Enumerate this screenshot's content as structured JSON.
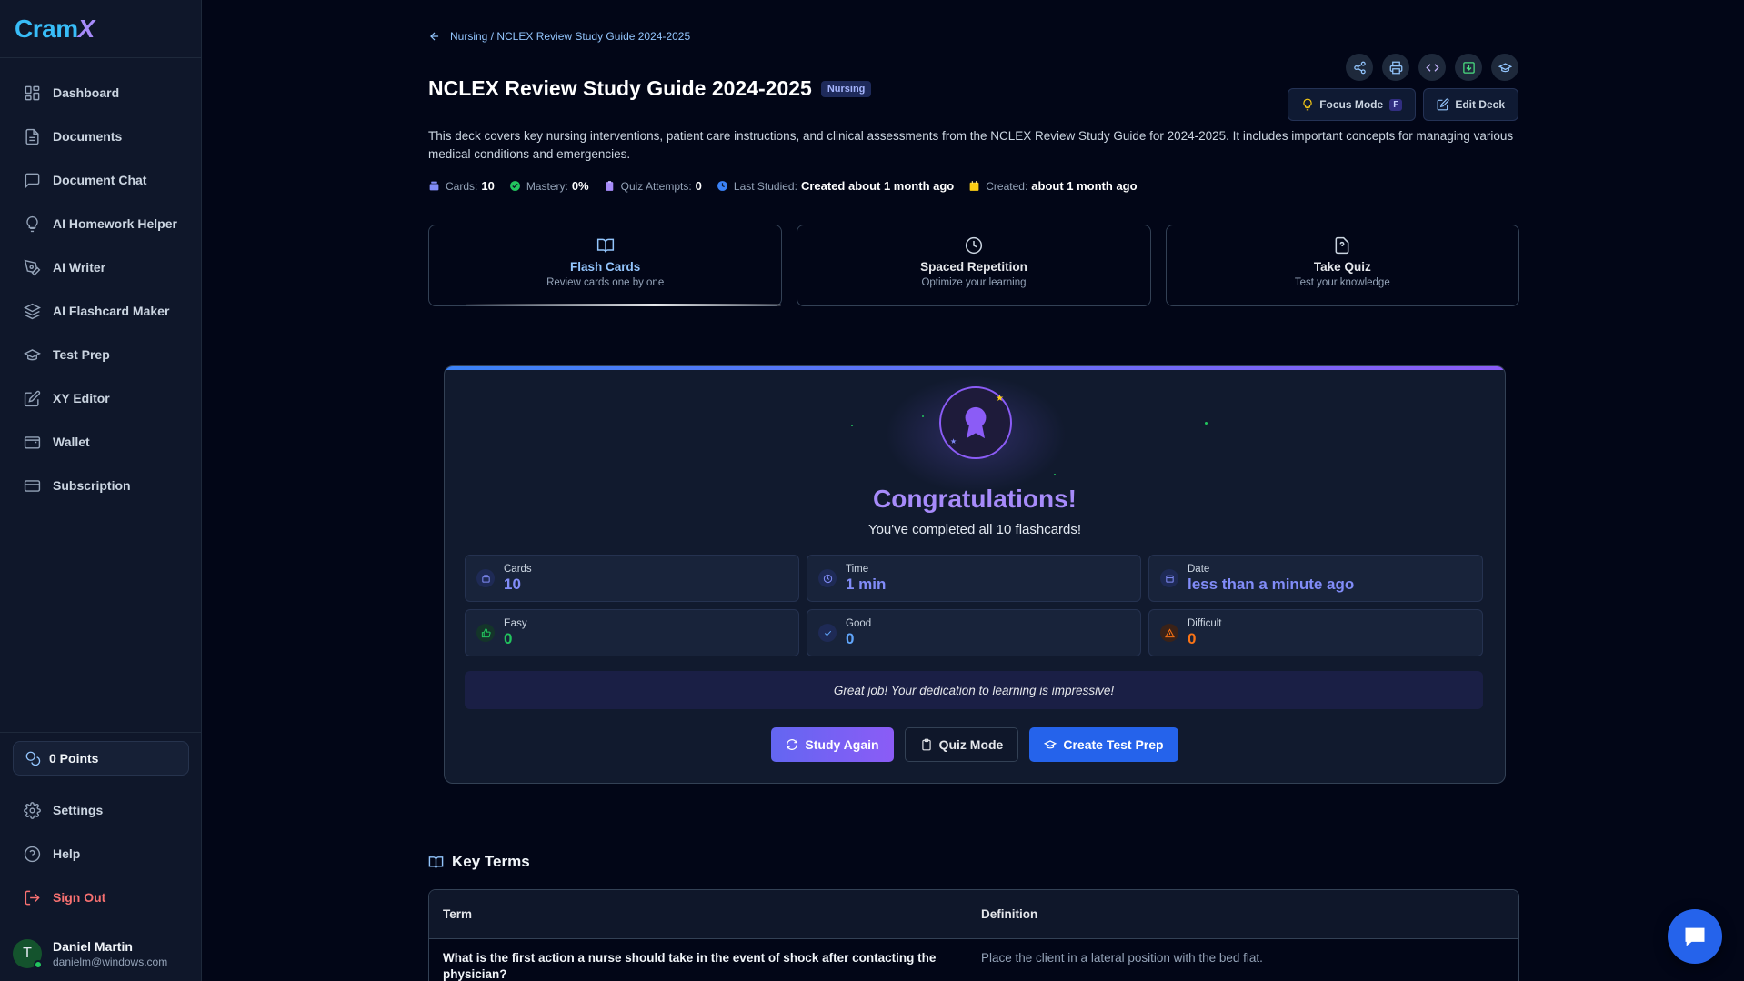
{
  "app": {
    "logo_a": "Cram",
    "logo_b": "X"
  },
  "sidebar": {
    "items": [
      {
        "label": "Dashboard",
        "icon": "grid-icon"
      },
      {
        "label": "Documents",
        "icon": "document-icon"
      },
      {
        "label": "Document Chat",
        "icon": "chat-icon"
      },
      {
        "label": "AI Homework Helper",
        "icon": "lightbulb-icon"
      },
      {
        "label": "AI Writer",
        "icon": "pen-tool-icon"
      },
      {
        "label": "AI Flashcard Maker",
        "icon": "layers-icon"
      },
      {
        "label": "Test Prep",
        "icon": "graduation-cap-icon"
      },
      {
        "label": "XY Editor",
        "icon": "edit-icon"
      },
      {
        "label": "Wallet",
        "icon": "wallet-icon"
      },
      {
        "label": "Subscription",
        "icon": "credit-card-icon"
      }
    ],
    "points": "0 Points",
    "bottom": [
      {
        "label": "Settings",
        "icon": "gear-icon"
      },
      {
        "label": "Help",
        "icon": "help-circle-icon"
      },
      {
        "label": "Sign Out",
        "icon": "logout-icon"
      }
    ],
    "user": {
      "initial": "T",
      "name": "Daniel Martin",
      "email": "danielm@windows.com"
    }
  },
  "header": {
    "breadcrumb": "Nursing / NCLEX Review Study Guide 2024-2025",
    "title": "NCLEX Review Study Guide 2024-2025",
    "tag": "Nursing",
    "focus_mode": "Focus Mode",
    "focus_key": "F",
    "edit_deck": "Edit Deck",
    "description": "This deck covers key nursing interventions, patient care instructions, and clinical assessments from the NCLEX Review Study Guide for 2024-2025. It includes important concepts for managing various medical conditions and emergencies.",
    "meta": {
      "cards_label": "Cards:",
      "cards": "10",
      "mastery_label": "Mastery:",
      "mastery": "0%",
      "quiz_label": "Quiz Attempts:",
      "quiz": "0",
      "last_label": "Last Studied:",
      "last": "Created about 1 month ago",
      "created_label": "Created:",
      "created": "about 1 month ago"
    }
  },
  "modes": [
    {
      "title": "Flash Cards",
      "sub": "Review cards one by one"
    },
    {
      "title": "Spaced Repetition",
      "sub": "Optimize your learning"
    },
    {
      "title": "Take Quiz",
      "sub": "Test your knowledge"
    }
  ],
  "congrats": {
    "title": "Congratulations!",
    "subtitle": "You've completed all 10 flashcards!",
    "stats": [
      {
        "label": "Cards",
        "value": "10"
      },
      {
        "label": "Time",
        "value": "1 min"
      },
      {
        "label": "Date",
        "value": "less than a minute ago"
      },
      {
        "label": "Easy",
        "value": "0"
      },
      {
        "label": "Good",
        "value": "0"
      },
      {
        "label": "Difficult",
        "value": "0"
      }
    ],
    "message": "Great job! Your dedication to learning is impressive!",
    "study_again": "Study Again",
    "quiz_mode": "Quiz Mode",
    "create_test_prep": "Create Test Prep"
  },
  "key_terms": {
    "heading": "Key Terms",
    "col_term": "Term",
    "col_definition": "Definition",
    "rows": [
      {
        "term": "What is the first action a nurse should take in the event of shock after contacting the physician?",
        "definition": "Place the client in a lateral position with the bed flat."
      }
    ]
  },
  "colors": {
    "accent": "#8b5cf6",
    "primary": "#2563eb",
    "easy": "#22c55e",
    "good": "#60a5fa",
    "difficult": "#f97316"
  }
}
